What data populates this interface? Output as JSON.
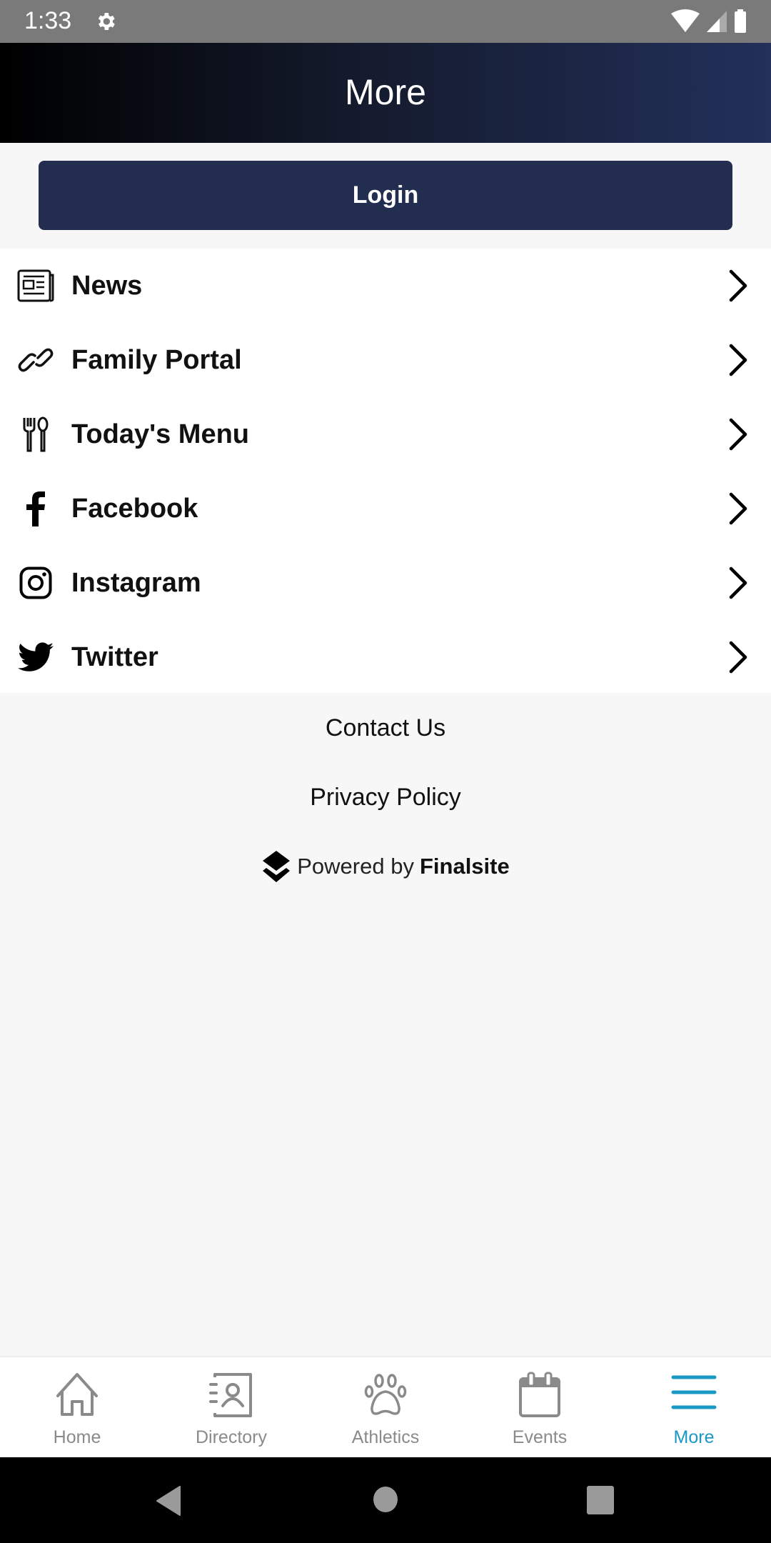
{
  "status_bar": {
    "time": "1:33",
    "icons": [
      "settings-gear-icon",
      "wifi-icon",
      "cell-signal-icon",
      "battery-icon"
    ]
  },
  "header": {
    "title": "More"
  },
  "login": {
    "label": "Login"
  },
  "menu": {
    "items": [
      {
        "label": "News",
        "icon": "newspaper-icon"
      },
      {
        "label": "Family Portal",
        "icon": "link-icon"
      },
      {
        "label": "Today's Menu",
        "icon": "fork-spoon-icon"
      },
      {
        "label": "Facebook",
        "icon": "facebook-icon"
      },
      {
        "label": "Instagram",
        "icon": "instagram-icon"
      },
      {
        "label": "Twitter",
        "icon": "twitter-icon"
      }
    ]
  },
  "footer": {
    "contact": "Contact Us",
    "privacy": "Privacy Policy",
    "powered_prefix": "Powered by",
    "powered_brand": "Finalsite"
  },
  "tabs": [
    {
      "label": "Home",
      "icon": "home-icon",
      "active": false
    },
    {
      "label": "Directory",
      "icon": "directory-icon",
      "active": false
    },
    {
      "label": "Athletics",
      "icon": "paw-icon",
      "active": false
    },
    {
      "label": "Events",
      "icon": "calendar-icon",
      "active": false
    },
    {
      "label": "More",
      "icon": "hamburger-menu-icon",
      "active": true
    }
  ],
  "colors": {
    "header_gradient_start": "#000000",
    "header_gradient_end": "#22305a",
    "login_button": "#222d50",
    "tab_active": "#1a98c4",
    "tab_inactive": "#8a8a8a"
  },
  "system_nav": [
    "back-button",
    "home-button",
    "recents-button"
  ]
}
